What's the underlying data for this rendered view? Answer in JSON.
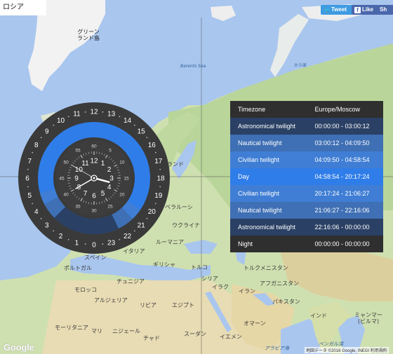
{
  "country_chip": "ロシア",
  "social": {
    "tweet": "Tweet",
    "like": "Like",
    "share": "Sh"
  },
  "map": {
    "google": "Google",
    "attribution": "地図データ ©2016 Google, INEGI  利用規約",
    "labels": {
      "greenland": "グリーン\nランド島",
      "barents_sea": "Barents Sea",
      "kara_sea": "カラ海",
      "finland_land": "ランド",
      "belarus": "ベラルーシ",
      "ukraine": "ウクライナ",
      "romania": "ルーマニア",
      "italy": "イタリア",
      "spain": "スペイン",
      "portugal": "ポルトガル",
      "greece": "ギリシャ",
      "turkey": "トルコ",
      "syria": "シリア",
      "iraq": "イラク",
      "iran": "イラン",
      "tunisia": "チュニジア",
      "morocco": "モロッコ",
      "algeria": "アルジェリア",
      "libya": "リビア",
      "egypt": "エジプト",
      "mauritania": "モーリタニア",
      "mali": "マリ",
      "niger": "ニジェール",
      "chad": "チャド",
      "sudan": "スーダン",
      "turkmenistan": "トルクメニスタン",
      "afghanistan": "アフガニスタン",
      "pakistan": "パキスタン",
      "india": "インド",
      "oman": "オマーン",
      "yemen": "イエメン",
      "arabian_sea": "アラビア海",
      "bay_of_bengal": "ベンガル湾",
      "myanmar": "ミャンマー\n(ビルマ)"
    }
  },
  "clock": {
    "hour_ring": [
      "12",
      "13",
      "14",
      "15",
      "16",
      "17",
      "18",
      "19",
      "20",
      "21",
      "22",
      "23",
      "0",
      "1",
      "2",
      "3",
      "4",
      "5",
      "6",
      "7",
      "8",
      "9",
      "10",
      "11"
    ],
    "minute_labels": [
      "60",
      "5",
      "10",
      "15",
      "20",
      "25",
      "30",
      "35",
      "40",
      "45",
      "50",
      "55"
    ],
    "hour_numerals": [
      "12",
      "1",
      "2",
      "3",
      "4",
      "5",
      "6",
      "7",
      "8",
      "9",
      "10",
      "11"
    ],
    "hand_angles": {
      "hour": 105,
      "minute": 240,
      "second": 300
    }
  },
  "timezone_table": {
    "header": {
      "label": "Timezone",
      "value": "Europe/Moscow"
    },
    "rows": [
      {
        "name": "Astronomical twilight",
        "range": "00:00:00 - 03:00:12",
        "color": "#2a4064"
      },
      {
        "name": "Nautical twilight",
        "range": "03:00:12 - 04:09:50",
        "color": "#3f6fb4"
      },
      {
        "name": "Civilian twilight",
        "range": "04:09:50 - 04:58:54",
        "color": "#3f7ed4"
      },
      {
        "name": "Day",
        "range": "04:58:54 - 20:17:24",
        "color": "#2f7de8"
      },
      {
        "name": "Civilian twilight",
        "range": "20:17:24 - 21:06:27",
        "color": "#3f7ed4"
      },
      {
        "name": "Nautical twilight",
        "range": "21:06:27 - 22:16:06",
        "color": "#3f6fb4"
      },
      {
        "name": "Astronomical twilight",
        "range": "22:16:06 - 00:00:00",
        "color": "#2a4064"
      },
      {
        "name": "Night",
        "range": "00:00:00 - 00:00:00",
        "color": "#2f2f2f"
      }
    ]
  }
}
